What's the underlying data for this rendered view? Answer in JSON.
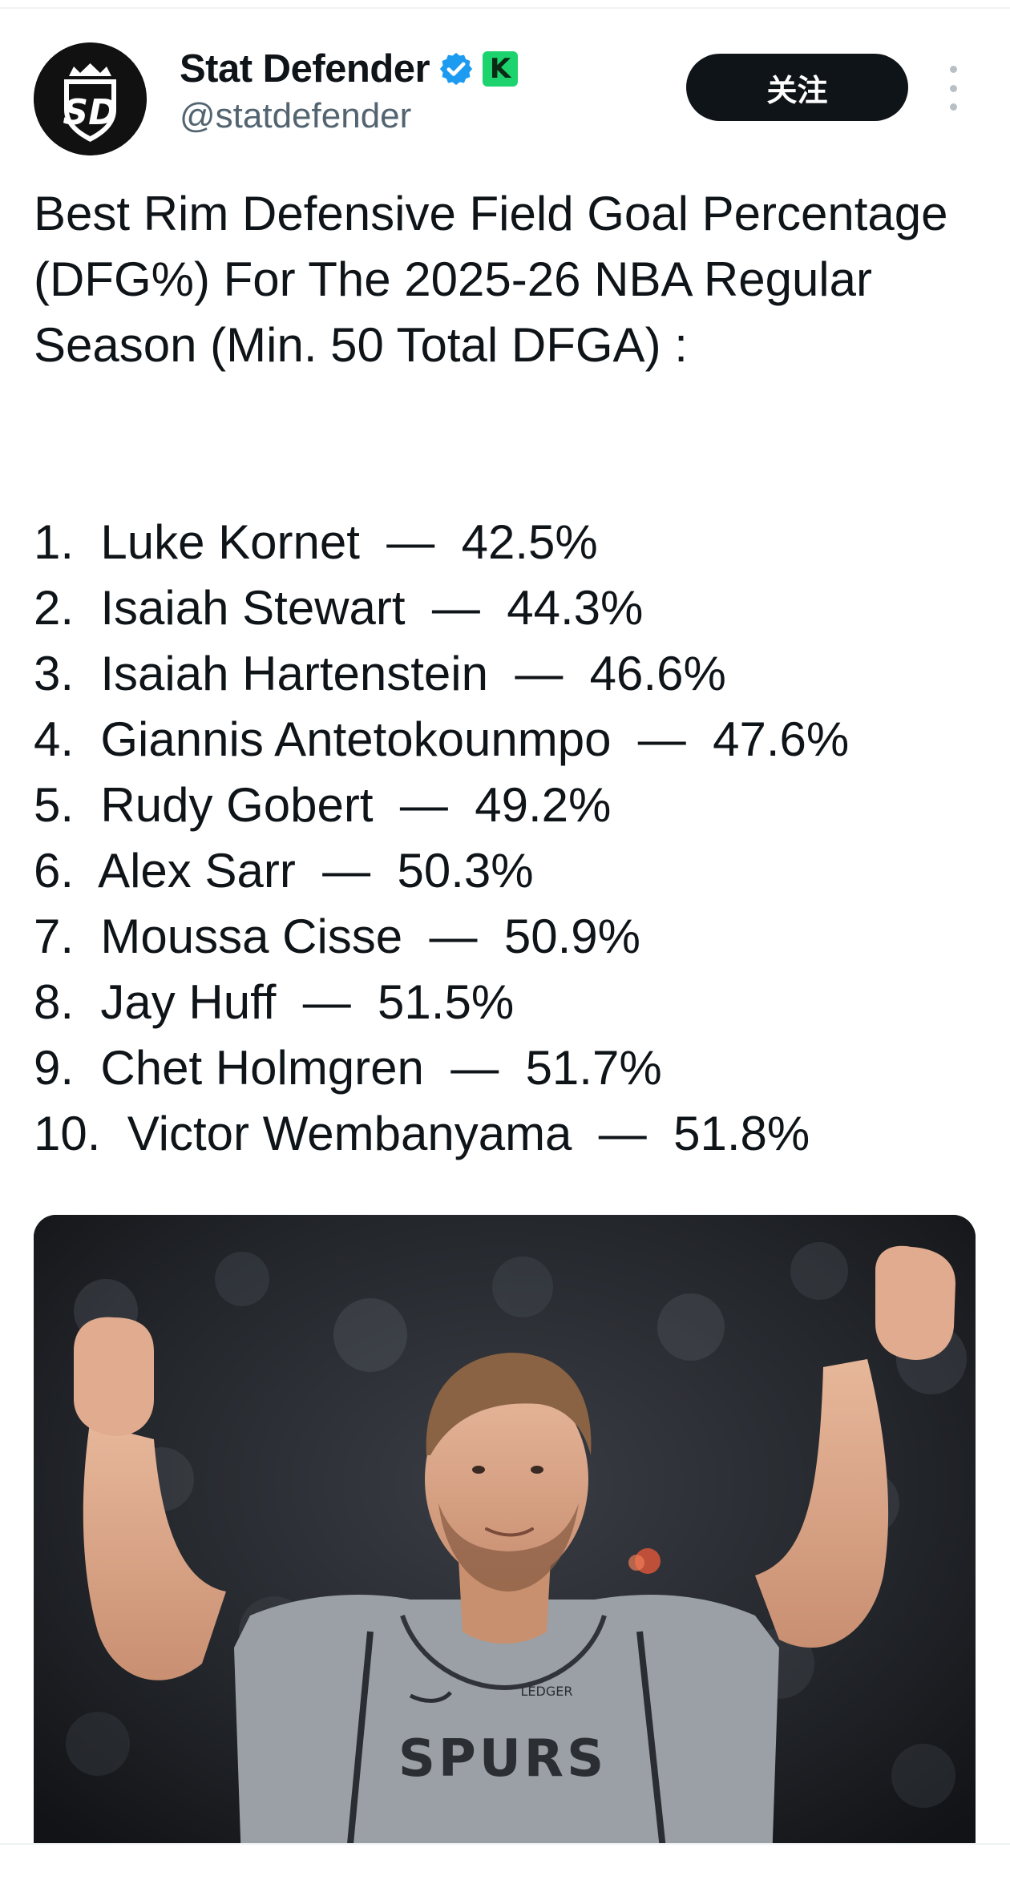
{
  "author": {
    "display_name": "Stat Defender",
    "handle": "@statdefender",
    "avatar_text": "SD",
    "verified_icon": "verified-badge-icon",
    "badge_letter": "K"
  },
  "actions": {
    "follow_label": "关注",
    "more_icon": "more-vertical-icon"
  },
  "post": {
    "intro": "Best Rim Defensive Field Goal Percentage (DFG%) For The 2025-26 NBA Regular Season (Min. 50 Total DFGA) :",
    "ranking": [
      "1.  Luke Kornet  —  42.5%",
      "2.  Isaiah Stewart  —  44.3%",
      "3.  Isaiah Hartenstein  —  46.6%",
      "4.  Giannis Antetokounmpo  —  47.6%",
      "5.  Rudy Gobert  —  49.2%",
      "6.  Alex Sarr  —  50.3%",
      "7.  Moussa Cisse  —  50.9%",
      "8.  Jay Huff  —  51.5%",
      "9.  Chet Holmgren  —  51.7%",
      "10.  Victor Wembanyama  —  51.8%"
    ]
  },
  "media": {
    "jersey_team": "SPURS",
    "jersey_sponsor": "LEDGER"
  },
  "colors": {
    "text": "#0f1419",
    "secondary_text": "#536471",
    "verified_blue": "#1d9bf0",
    "k_badge_green": "#1dd36e",
    "follow_button": "#0f1419"
  }
}
